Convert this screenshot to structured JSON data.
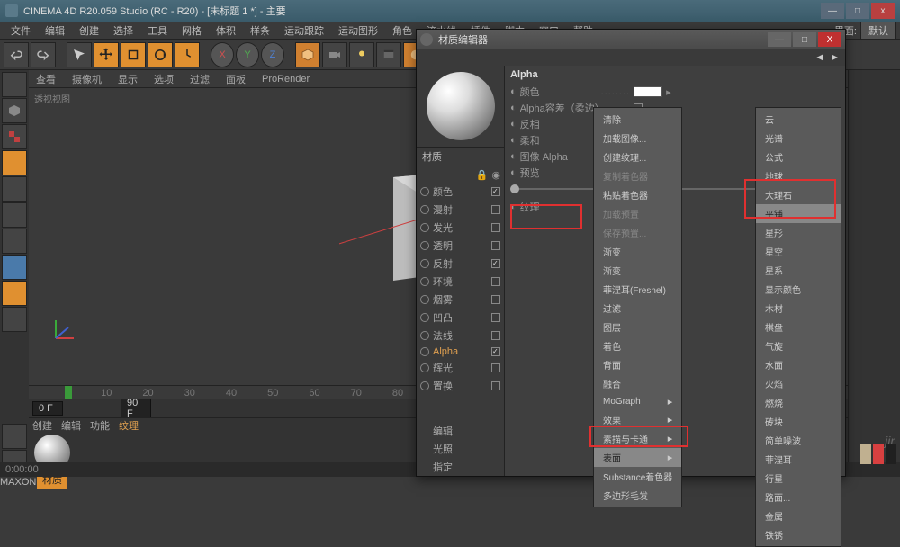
{
  "window": {
    "title": "CINEMA 4D R20.059 Studio (RC - R20) - [未标题 1 *] - 主要",
    "min": "—",
    "max": "□",
    "close": "x"
  },
  "menu": {
    "items": [
      "文件",
      "编辑",
      "创建",
      "选择",
      "工具",
      "网格",
      "体积",
      "样条",
      "运动跟踪",
      "运动图形",
      "角色",
      "流水线",
      "插件",
      "脚本",
      "窗口",
      "帮助"
    ],
    "right_label": "界面:",
    "right_value": "默认"
  },
  "toolbar": {
    "history": [
      "undo",
      "redo"
    ],
    "select_tools": [
      "live-select",
      "move",
      "scale",
      "rotate",
      "recent"
    ],
    "axis": [
      "X",
      "Y",
      "Z"
    ],
    "right_icons": [
      "cube",
      "camera",
      "light",
      "film",
      "material",
      "deformer",
      "render-settings",
      "render",
      "help"
    ]
  },
  "left_tools": [
    "select",
    "cube",
    "checker",
    "grid",
    "sphere",
    "cube2",
    "cylinder",
    "l-shape",
    "mouse",
    "target"
  ],
  "view": {
    "tabs": [
      "查看",
      "摄像机",
      "显示",
      "选项",
      "过滤",
      "面板",
      "ProRender"
    ],
    "label": "透视视图"
  },
  "timeline": {
    "ticks": [
      "0",
      "10",
      "20",
      "30",
      "40",
      "50",
      "60",
      "70",
      "80",
      "90"
    ],
    "start": "0 F",
    "end": "90 F",
    "current": "0 F"
  },
  "mat_panel": {
    "tabs": [
      "创建",
      "编辑",
      "功能",
      "纹理"
    ],
    "label": "材质"
  },
  "status": {
    "time": "0:00:00"
  },
  "dialog": {
    "title": "材质编辑器",
    "arrows": [
      "◄",
      "►"
    ],
    "preview_label": "材质",
    "channels": [
      {
        "name": "颜色",
        "on": true
      },
      {
        "name": "漫射",
        "on": false
      },
      {
        "name": "发光",
        "on": false
      },
      {
        "name": "透明",
        "on": false
      },
      {
        "name": "反射",
        "on": true
      },
      {
        "name": "环境",
        "on": false
      },
      {
        "name": "烟雾",
        "on": false
      },
      {
        "name": "凹凸",
        "on": false
      },
      {
        "name": "法线",
        "on": false
      },
      {
        "name": "Alpha",
        "on": true,
        "active": true
      },
      {
        "name": "辉光",
        "on": false
      },
      {
        "name": "置换",
        "on": false
      }
    ],
    "extras": [
      "编辑",
      "光照",
      "指定"
    ],
    "section": "Alpha",
    "props": {
      "color_label": "颜色",
      "alpha_label": "Alpha容差（柔边）",
      "invert_label": "反相",
      "soft_label": "柔和",
      "image_alpha_label": "图像 Alpha",
      "preview_label": "预览",
      "texture_label": "纹理"
    }
  },
  "menu1": {
    "items": [
      {
        "t": "清除"
      },
      {
        "t": "加载图像..."
      },
      {
        "t": "创建纹理..."
      },
      {
        "t": "复制着色器",
        "d": true
      },
      {
        "t": "粘贴着色器"
      },
      {
        "t": "加载预置",
        "d": true
      },
      {
        "t": "保存预置...",
        "d": true
      },
      {
        "t": "渐变"
      },
      {
        "t": "渐变"
      },
      {
        "t": "菲涅耳(Fresnel)"
      },
      {
        "t": "过滤"
      },
      {
        "t": "图层"
      },
      {
        "t": "着色"
      },
      {
        "t": "背面"
      },
      {
        "t": "融合"
      },
      {
        "t": "MoGraph",
        "s": true
      },
      {
        "t": "效果",
        "s": true
      },
      {
        "t": "素描与卡通",
        "s": true
      },
      {
        "t": "表面",
        "s": true,
        "sel": true
      },
      {
        "t": "Substance着色器"
      },
      {
        "t": "多边形毛发"
      }
    ]
  },
  "menu2": {
    "items": [
      {
        "t": "云"
      },
      {
        "t": "光谱"
      },
      {
        "t": "公式"
      },
      {
        "t": "地球"
      },
      {
        "t": "大理石"
      },
      {
        "t": "平铺",
        "sel": true
      },
      {
        "t": "星形"
      },
      {
        "t": "星空"
      },
      {
        "t": "星系"
      },
      {
        "t": "显示颜色"
      },
      {
        "t": "木材"
      },
      {
        "t": "棋盘"
      },
      {
        "t": "气旋"
      },
      {
        "t": "水面"
      },
      {
        "t": "火焰"
      },
      {
        "t": "燃烧"
      },
      {
        "t": "砖块"
      },
      {
        "t": "简单噪波"
      },
      {
        "t": "菲涅耳"
      },
      {
        "t": "行星"
      },
      {
        "t": "路面..."
      },
      {
        "t": "金属"
      },
      {
        "t": "铁锈"
      }
    ]
  },
  "watermark": "jir",
  "colors": {
    "chips": [
      "#c0b090",
      "#d84040",
      "#202020"
    ]
  }
}
